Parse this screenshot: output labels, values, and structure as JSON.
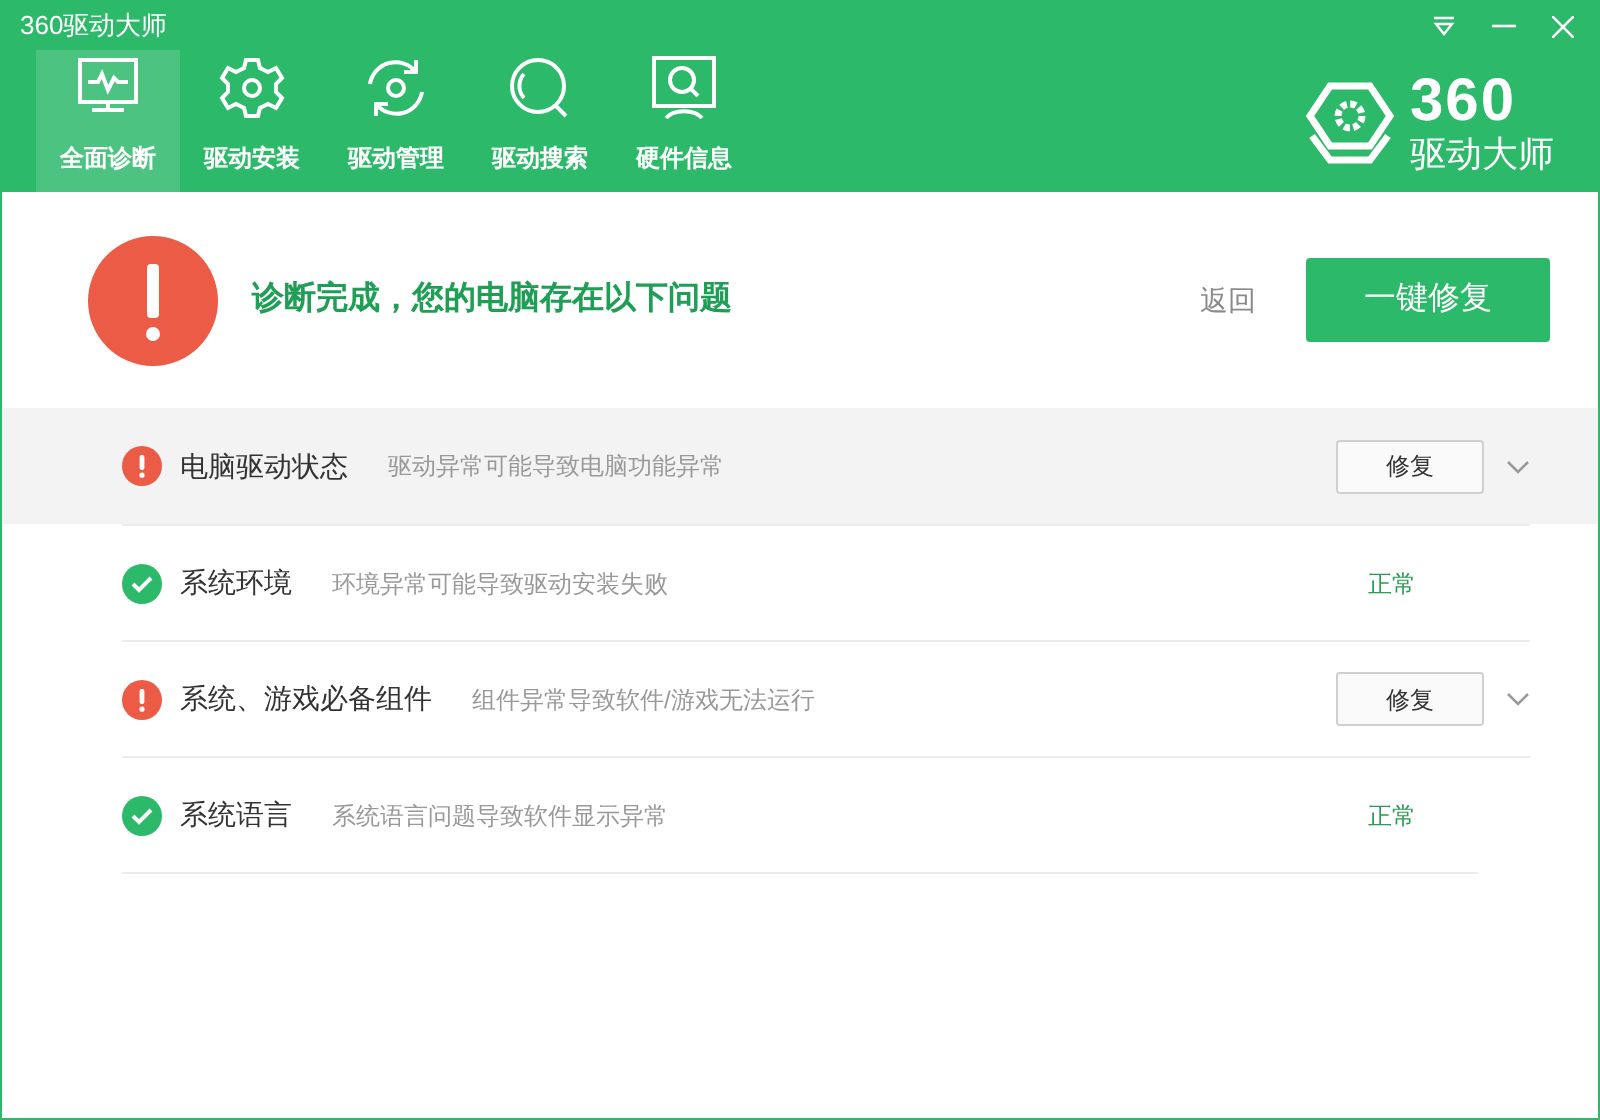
{
  "window": {
    "title": "360驱动大师"
  },
  "tabs": [
    {
      "label": "全面诊断",
      "selected": true
    },
    {
      "label": "驱动安装",
      "selected": false
    },
    {
      "label": "驱动管理",
      "selected": false
    },
    {
      "label": "驱动搜索",
      "selected": false
    },
    {
      "label": "硬件信息",
      "selected": false
    }
  ],
  "logo": {
    "title": "360",
    "subtitle": "驱动大师"
  },
  "summary": {
    "message": "诊断完成，您的电脑存在以下问题",
    "back": "返回",
    "action": "一键修复"
  },
  "rows": [
    {
      "kind": "issue",
      "title": "电脑驱动状态",
      "description": "驱动异常可能导致电脑功能异常",
      "button": "修复",
      "highlighted": true
    },
    {
      "kind": "ok",
      "title": "系统环境",
      "description": "环境异常可能导致驱动安装失败",
      "status": "正常",
      "highlighted": false
    },
    {
      "kind": "issue",
      "title": "系统、游戏必备组件",
      "description": "组件异常导致软件/游戏无法运行",
      "button": "修复",
      "highlighted": false
    },
    {
      "kind": "ok",
      "title": "系统语言",
      "description": "系统语言问题导致软件显示异常",
      "status": "正常",
      "highlighted": false
    }
  ]
}
